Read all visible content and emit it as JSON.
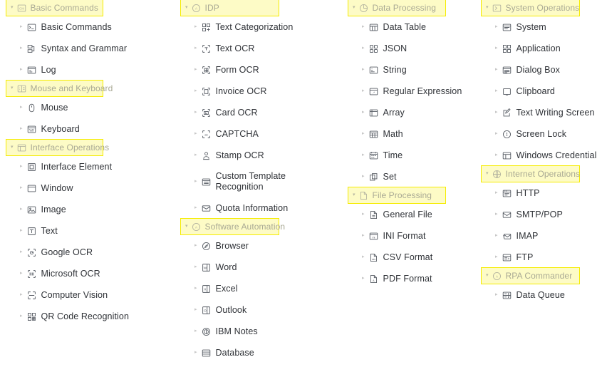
{
  "theme": {
    "highlight_fill": "#fdfbc6",
    "highlight_border": "#f5ec00",
    "header_text": "#a9a994",
    "item_text": "#2f3237",
    "icon_color": "#565b63",
    "caret_color": "#c6c6c6",
    "background": "#ffffff"
  },
  "caret_glyph": "▾",
  "item_caret_glyph": "▸",
  "columns": [
    {
      "id": "column-1",
      "groups": [
        {
          "label": "Basic Commands",
          "icon": "command-box-icon",
          "expanded": true,
          "items": [
            {
              "label": "Basic Commands",
              "icon": "console-icon"
            },
            {
              "label": "Syntax and Grammar",
              "icon": "branch-icon"
            },
            {
              "label": "Log",
              "icon": "log-icon"
            }
          ]
        },
        {
          "label": "Mouse and Keyboard",
          "icon": "mouse-keyboard-icon",
          "expanded": true,
          "items": [
            {
              "label": "Mouse",
              "icon": "mouse-icon"
            },
            {
              "label": "Keyboard",
              "icon": "keyboard-icon"
            }
          ]
        },
        {
          "label": "Interface Operations",
          "icon": "interface-icon",
          "expanded": true,
          "items": [
            {
              "label": "Interface Element",
              "icon": "element-icon"
            },
            {
              "label": "Window",
              "icon": "window-icon"
            },
            {
              "label": "Image",
              "icon": "image-icon"
            },
            {
              "label": "Text",
              "icon": "text-box-icon"
            },
            {
              "label": "Google OCR",
              "icon": "google-ocr-icon"
            },
            {
              "label": "Microsoft OCR",
              "icon": "microsoft-ocr-icon"
            },
            {
              "label": "Computer Vision",
              "icon": "computer-vision-icon"
            },
            {
              "label": "QR Code Recognition",
              "icon": "qr-code-icon"
            }
          ]
        }
      ]
    },
    {
      "id": "column-2",
      "groups": [
        {
          "label": "IDP",
          "icon": "idp-circle-icon",
          "expanded": true,
          "items": [
            {
              "label": "Text Categorization",
              "icon": "categorization-icon"
            },
            {
              "label": "Text OCR",
              "icon": "text-ocr-icon"
            },
            {
              "label": "Form OCR",
              "icon": "form-ocr-icon"
            },
            {
              "label": "Invoice OCR",
              "icon": "invoice-ocr-icon"
            },
            {
              "label": "Card OCR",
              "icon": "card-ocr-icon"
            },
            {
              "label": "CAPTCHA",
              "icon": "captcha-icon"
            },
            {
              "label": "Stamp OCR",
              "icon": "stamp-ocr-icon"
            },
            {
              "label": "Custom Template Recognition",
              "icon": "template-icon",
              "wrap": true
            },
            {
              "label": "Quota Information",
              "icon": "quota-icon"
            }
          ]
        },
        {
          "label": "Software Automation",
          "icon": "software-automation-icon",
          "expanded": true,
          "items": [
            {
              "label": "Browser",
              "icon": "browser-icon"
            },
            {
              "label": "Word",
              "icon": "word-icon"
            },
            {
              "label": "Excel",
              "icon": "excel-icon"
            },
            {
              "label": "Outlook",
              "icon": "outlook-icon"
            },
            {
              "label": "IBM Notes",
              "icon": "ibm-notes-icon"
            },
            {
              "label": "Database",
              "icon": "database-icon"
            }
          ]
        }
      ]
    },
    {
      "id": "column-3",
      "groups": [
        {
          "label": "Data Processing",
          "icon": "data-processing-icon",
          "expanded": true,
          "items": [
            {
              "label": "Data Table",
              "icon": "data-table-icon"
            },
            {
              "label": "JSON",
              "icon": "json-icon"
            },
            {
              "label": "String",
              "icon": "string-icon"
            },
            {
              "label": "Regular Expression",
              "icon": "regex-icon"
            },
            {
              "label": "Array",
              "icon": "array-icon"
            },
            {
              "label": "Math",
              "icon": "math-icon"
            },
            {
              "label": "Time",
              "icon": "time-icon"
            },
            {
              "label": "Set",
              "icon": "set-icon"
            }
          ]
        },
        {
          "label": "File Processing",
          "icon": "file-processing-icon",
          "expanded": true,
          "items": [
            {
              "label": "General File",
              "icon": "general-file-icon"
            },
            {
              "label": "INI Format",
              "icon": "ini-file-icon"
            },
            {
              "label": "CSV Format",
              "icon": "csv-file-icon"
            },
            {
              "label": "PDF Format",
              "icon": "pdf-file-icon"
            }
          ]
        }
      ]
    },
    {
      "id": "column-4",
      "groups": [
        {
          "label": "System Operations",
          "icon": "system-operations-icon",
          "expanded": true,
          "items": [
            {
              "label": "System",
              "icon": "system-icon"
            },
            {
              "label": "Application",
              "icon": "application-icon"
            },
            {
              "label": "Dialog Box",
              "icon": "dialog-box-icon"
            },
            {
              "label": "Clipboard",
              "icon": "clipboard-icon"
            },
            {
              "label": "Text Writing Screen",
              "icon": "text-writing-icon"
            },
            {
              "label": "Screen Lock",
              "icon": "screen-lock-icon"
            },
            {
              "label": "Windows Credential",
              "icon": "credential-icon"
            }
          ]
        },
        {
          "label": "Internet Operations",
          "icon": "globe-icon",
          "expanded": true,
          "items": [
            {
              "label": "HTTP",
              "icon": "http-icon"
            },
            {
              "label": "SMTP/POP",
              "icon": "smtp-icon"
            },
            {
              "label": "IMAP",
              "icon": "imap-icon"
            },
            {
              "label": "FTP",
              "icon": "ftp-icon"
            }
          ]
        },
        {
          "label": "RPA Commander",
          "icon": "rpa-commander-icon",
          "expanded": true,
          "items": [
            {
              "label": "Data Queue",
              "icon": "data-queue-icon"
            }
          ]
        }
      ]
    }
  ]
}
